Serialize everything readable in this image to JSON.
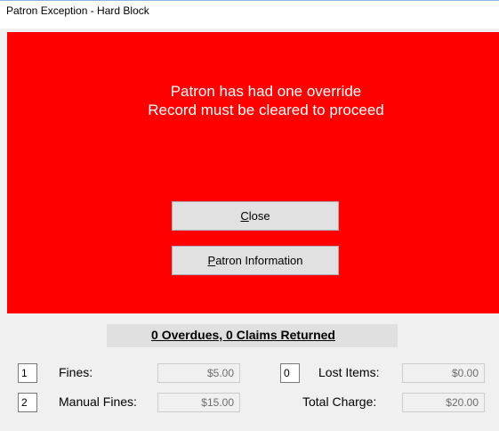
{
  "window": {
    "title": "Patron Exception - Hard Block"
  },
  "alert": {
    "line1": "Patron has had one override",
    "line2": "Record must be cleared to proceed",
    "background_color": "#ff0000"
  },
  "buttons": {
    "close_mnemonic": "C",
    "close_rest": "lose",
    "patron_info_mnemonic": "P",
    "patron_info_rest": "atron Information"
  },
  "summary": {
    "text": "0 Overdues, 0 Claims Returned"
  },
  "fines": {
    "count": "1",
    "label": "Fines:",
    "amount": "$5.00"
  },
  "manual_fines": {
    "count": "2",
    "label": "Manual Fines:",
    "amount": "$15.00"
  },
  "lost_items": {
    "count": "0",
    "label": "Lost Items:",
    "amount": "$0.00"
  },
  "total_charge": {
    "label": "Total Charge:",
    "amount": "$20.00"
  }
}
